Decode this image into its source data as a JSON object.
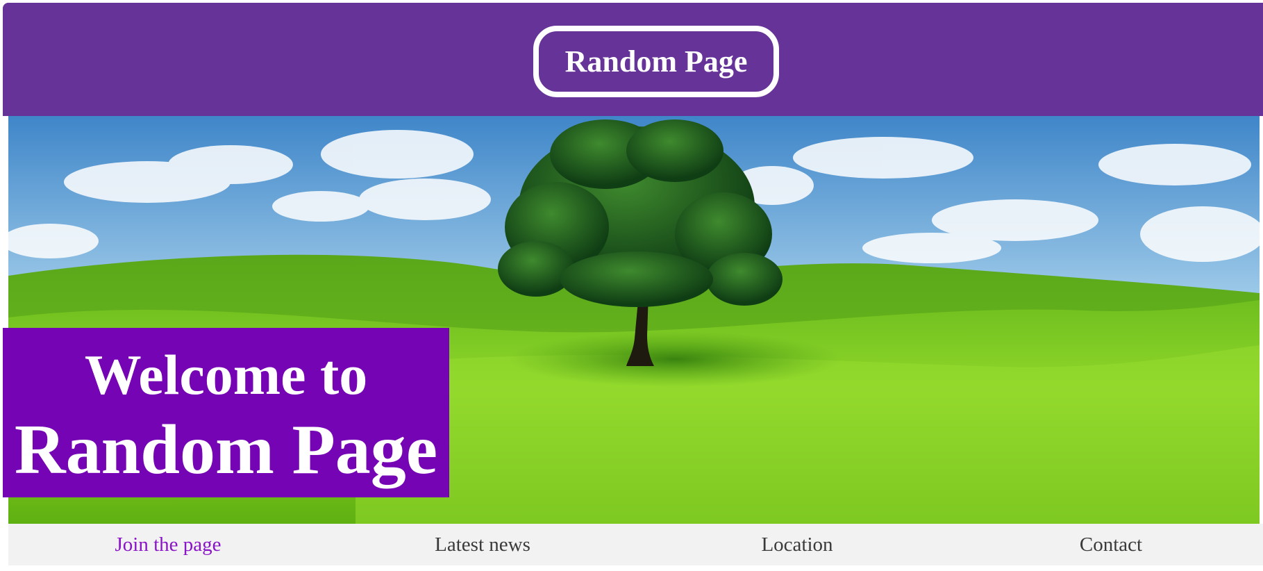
{
  "header": {
    "logo_text": "Random Page",
    "background_color": "#663399"
  },
  "hero": {
    "image_description_icon": "landscape-tree-image",
    "welcome_line1": "Welcome to",
    "welcome_line2": "Random Page",
    "welcome_box_color": "#7504b5"
  },
  "nav": {
    "items": [
      {
        "label": "Join the page",
        "active": true
      },
      {
        "label": "Latest news",
        "active": false
      },
      {
        "label": "Location",
        "active": false
      },
      {
        "label": "Contact",
        "active": false
      }
    ],
    "active_color": "#8a14c7",
    "background_color": "#f2f2f2"
  }
}
